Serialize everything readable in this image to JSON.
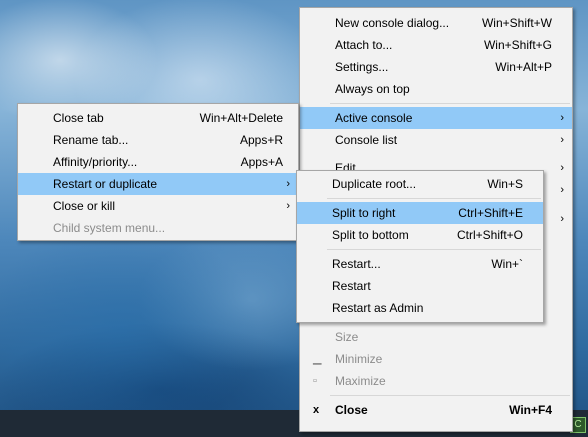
{
  "main_menu": {
    "new_console": {
      "label": "New console dialog...",
      "shortcut": "Win+Shift+W"
    },
    "attach": {
      "label": "Attach to...",
      "shortcut": "Win+Shift+G"
    },
    "settings": {
      "label": "Settings...",
      "shortcut": "Win+Alt+P"
    },
    "always_on_top": {
      "label": "Always on top"
    },
    "active_console": {
      "label": "Active console"
    },
    "console_list": {
      "label": "Console list"
    },
    "edit": {
      "label": "Edit"
    },
    "size": {
      "label": "Size"
    },
    "minimize": {
      "label": "Minimize"
    },
    "maximize": {
      "label": "Maximize"
    },
    "close": {
      "label": "Close",
      "shortcut": "Win+F4"
    }
  },
  "tab_menu": {
    "close_tab": {
      "label": "Close tab",
      "shortcut": "Win+Alt+Delete"
    },
    "rename_tab": {
      "label": "Rename tab...",
      "shortcut": "Apps+R"
    },
    "affinity": {
      "label": "Affinity/priority...",
      "shortcut": "Apps+A"
    },
    "restart_or_duplicate": {
      "label": "Restart or duplicate"
    },
    "close_or_kill": {
      "label": "Close or kill"
    },
    "child_system_menu": {
      "label": "Child system menu..."
    }
  },
  "restart_menu": {
    "duplicate_root": {
      "label": "Duplicate root...",
      "shortcut": "Win+S"
    },
    "split_right": {
      "label": "Split to right",
      "shortcut": "Ctrl+Shift+E"
    },
    "split_bottom": {
      "label": "Split to bottom",
      "shortcut": "Ctrl+Shift+O"
    },
    "restart_dialog": {
      "label": "Restart...",
      "shortcut": "Win+`"
    },
    "restart": {
      "label": "Restart"
    },
    "restart_admin": {
      "label": "Restart as Admin"
    }
  },
  "icons": {
    "submenu_arrow": "chevron-right-icon",
    "minimize": "minimize-icon",
    "maximize": "maximize-icon",
    "close": "close-icon"
  },
  "colors": {
    "highlight": "#91c9f7",
    "menu_bg": "#f2f2f2",
    "disabled_text": "#8c8c8c"
  }
}
